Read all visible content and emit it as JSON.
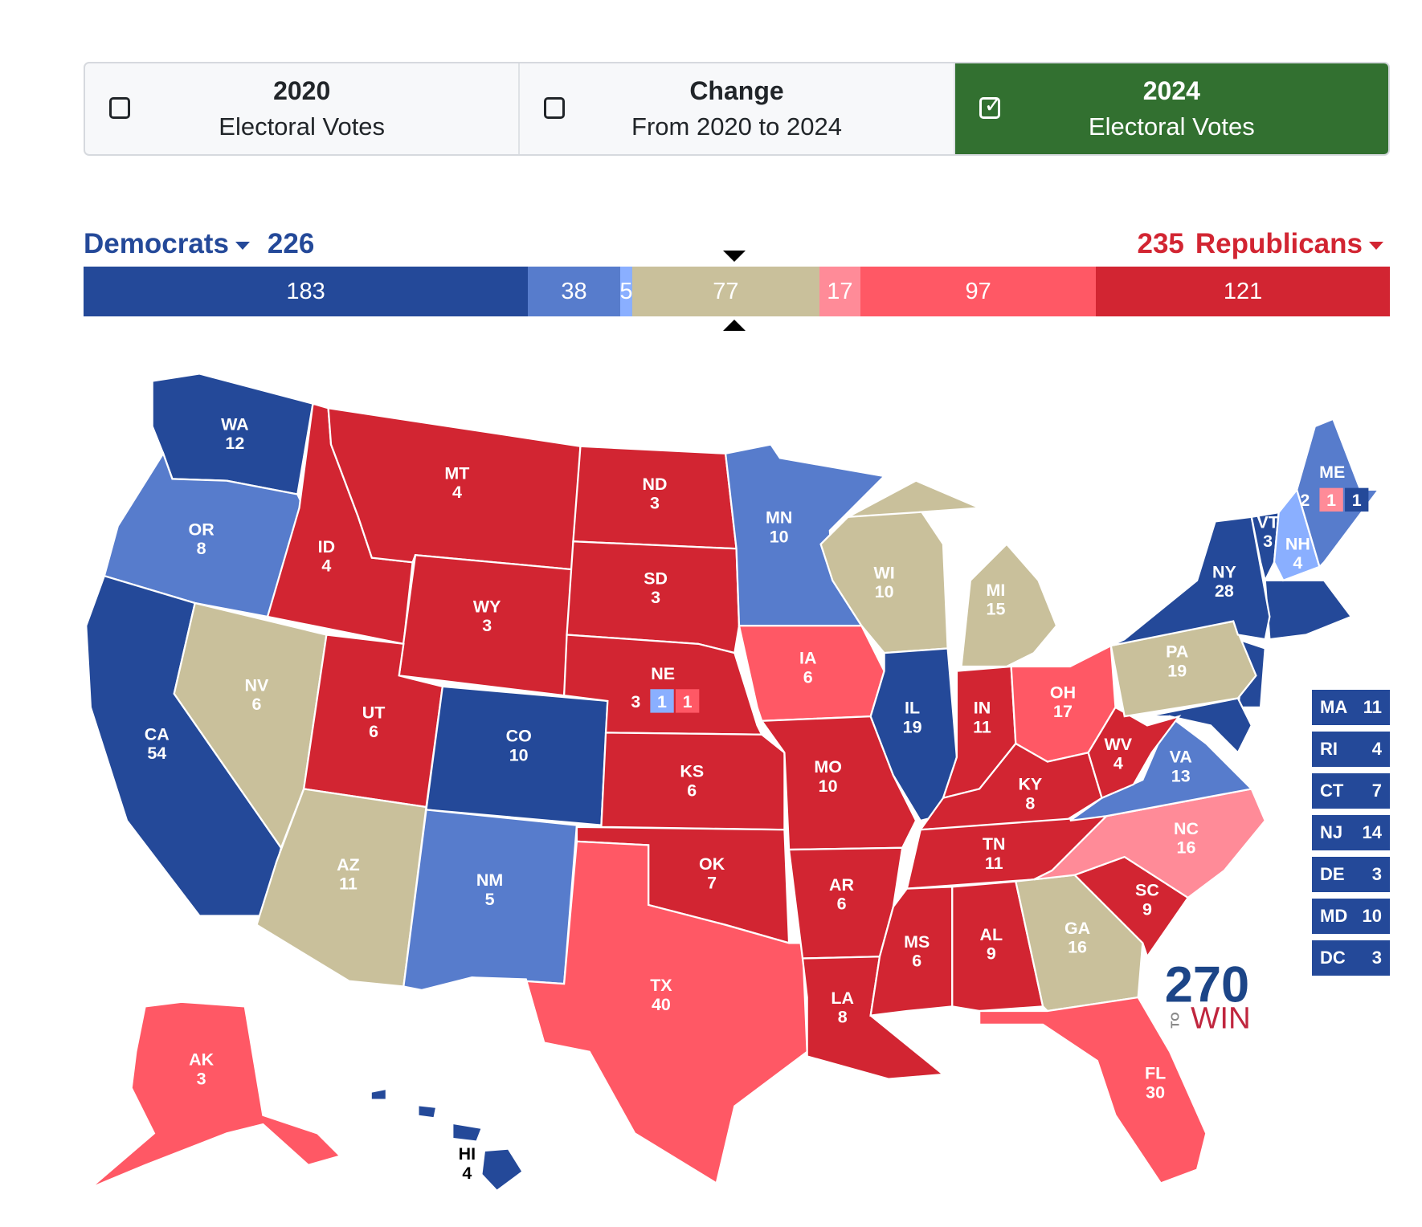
{
  "tabs": [
    {
      "title": "2020",
      "subtitle": "Electoral Votes",
      "checked": false
    },
    {
      "title": "Change",
      "subtitle": "From 2020 to 2024",
      "checked": false
    },
    {
      "title": "2024",
      "subtitle": "Electoral Votes",
      "checked": true
    }
  ],
  "democrats": {
    "label": "Democrats",
    "total": "226",
    "color": "#244999"
  },
  "republicans": {
    "label": "Republicans",
    "total": "235",
    "color": "#d22532"
  },
  "ratings": {
    "safe-d": "#244999",
    "likely-d": "#577ccc",
    "lean-d": "#8aafff",
    "tossup": "#c9c09b",
    "lean-r": "#ff8b98",
    "likely-r": "#ff5865",
    "safe-r": "#d22532"
  },
  "bar": [
    {
      "rating": "safe-d",
      "value": 183
    },
    {
      "rating": "likely-d",
      "value": 38
    },
    {
      "rating": "lean-d",
      "value": 5
    },
    {
      "rating": "tossup",
      "value": 77
    },
    {
      "rating": "lean-r",
      "value": 17
    },
    {
      "rating": "likely-r",
      "value": 97
    },
    {
      "rating": "safe-r",
      "value": 121
    }
  ],
  "states": [
    {
      "abbr": "WA",
      "ev": 12,
      "rating": "safe-d"
    },
    {
      "abbr": "OR",
      "ev": 8,
      "rating": "likely-d"
    },
    {
      "abbr": "CA",
      "ev": 54,
      "rating": "safe-d"
    },
    {
      "abbr": "NV",
      "ev": 6,
      "rating": "tossup"
    },
    {
      "abbr": "ID",
      "ev": 4,
      "rating": "safe-r"
    },
    {
      "abbr": "MT",
      "ev": 4,
      "rating": "safe-r"
    },
    {
      "abbr": "WY",
      "ev": 3,
      "rating": "safe-r"
    },
    {
      "abbr": "UT",
      "ev": 6,
      "rating": "safe-r"
    },
    {
      "abbr": "AZ",
      "ev": 11,
      "rating": "tossup"
    },
    {
      "abbr": "CO",
      "ev": 10,
      "rating": "safe-d"
    },
    {
      "abbr": "NM",
      "ev": 5,
      "rating": "likely-d"
    },
    {
      "abbr": "ND",
      "ev": 3,
      "rating": "safe-r"
    },
    {
      "abbr": "SD",
      "ev": 3,
      "rating": "safe-r"
    },
    {
      "abbr": "NE",
      "ev": 3,
      "rating": "safe-r",
      "districts": [
        {
          "ev": 1,
          "rating": "lean-d"
        },
        {
          "ev": 1,
          "rating": "likely-r"
        }
      ]
    },
    {
      "abbr": "KS",
      "ev": 6,
      "rating": "safe-r"
    },
    {
      "abbr": "OK",
      "ev": 7,
      "rating": "safe-r"
    },
    {
      "abbr": "TX",
      "ev": 40,
      "rating": "likely-r"
    },
    {
      "abbr": "MN",
      "ev": 10,
      "rating": "likely-d"
    },
    {
      "abbr": "IA",
      "ev": 6,
      "rating": "likely-r"
    },
    {
      "abbr": "MO",
      "ev": 10,
      "rating": "safe-r"
    },
    {
      "abbr": "AR",
      "ev": 6,
      "rating": "safe-r"
    },
    {
      "abbr": "LA",
      "ev": 8,
      "rating": "safe-r"
    },
    {
      "abbr": "WI",
      "ev": 10,
      "rating": "tossup"
    },
    {
      "abbr": "IL",
      "ev": 19,
      "rating": "safe-d"
    },
    {
      "abbr": "MI",
      "ev": 15,
      "rating": "tossup"
    },
    {
      "abbr": "IN",
      "ev": 11,
      "rating": "safe-r"
    },
    {
      "abbr": "OH",
      "ev": 17,
      "rating": "likely-r"
    },
    {
      "abbr": "KY",
      "ev": 8,
      "rating": "safe-r"
    },
    {
      "abbr": "TN",
      "ev": 11,
      "rating": "safe-r"
    },
    {
      "abbr": "MS",
      "ev": 6,
      "rating": "safe-r"
    },
    {
      "abbr": "AL",
      "ev": 9,
      "rating": "safe-r"
    },
    {
      "abbr": "GA",
      "ev": 16,
      "rating": "tossup"
    },
    {
      "abbr": "FL",
      "ev": 30,
      "rating": "likely-r"
    },
    {
      "abbr": "SC",
      "ev": 9,
      "rating": "safe-r"
    },
    {
      "abbr": "NC",
      "ev": 16,
      "rating": "lean-r"
    },
    {
      "abbr": "VA",
      "ev": 13,
      "rating": "likely-d"
    },
    {
      "abbr": "WV",
      "ev": 4,
      "rating": "safe-r"
    },
    {
      "abbr": "PA",
      "ev": 19,
      "rating": "tossup"
    },
    {
      "abbr": "NY",
      "ev": 28,
      "rating": "safe-d"
    },
    {
      "abbr": "VT",
      "ev": 3,
      "rating": "safe-d"
    },
    {
      "abbr": "NH",
      "ev": 4,
      "rating": "lean-d"
    },
    {
      "abbr": "ME",
      "ev": 2,
      "rating": "likely-d",
      "districts": [
        {
          "ev": 1,
          "rating": "lean-r"
        },
        {
          "ev": 1,
          "rating": "safe-d"
        }
      ]
    },
    {
      "abbr": "AK",
      "ev": 3,
      "rating": "likely-r"
    },
    {
      "abbr": "HI",
      "ev": 4,
      "rating": "safe-d"
    }
  ],
  "small_states": [
    {
      "abbr": "MA",
      "ev": "11"
    },
    {
      "abbr": "RI",
      "ev": "4"
    },
    {
      "abbr": "CT",
      "ev": "7"
    },
    {
      "abbr": "NJ",
      "ev": "14"
    },
    {
      "abbr": "DE",
      "ev": "3"
    },
    {
      "abbr": "MD",
      "ev": "10"
    },
    {
      "abbr": "DC",
      "ev": "3"
    }
  ],
  "logo": {
    "number": "270",
    "to": "TO",
    "win": "WIN"
  }
}
